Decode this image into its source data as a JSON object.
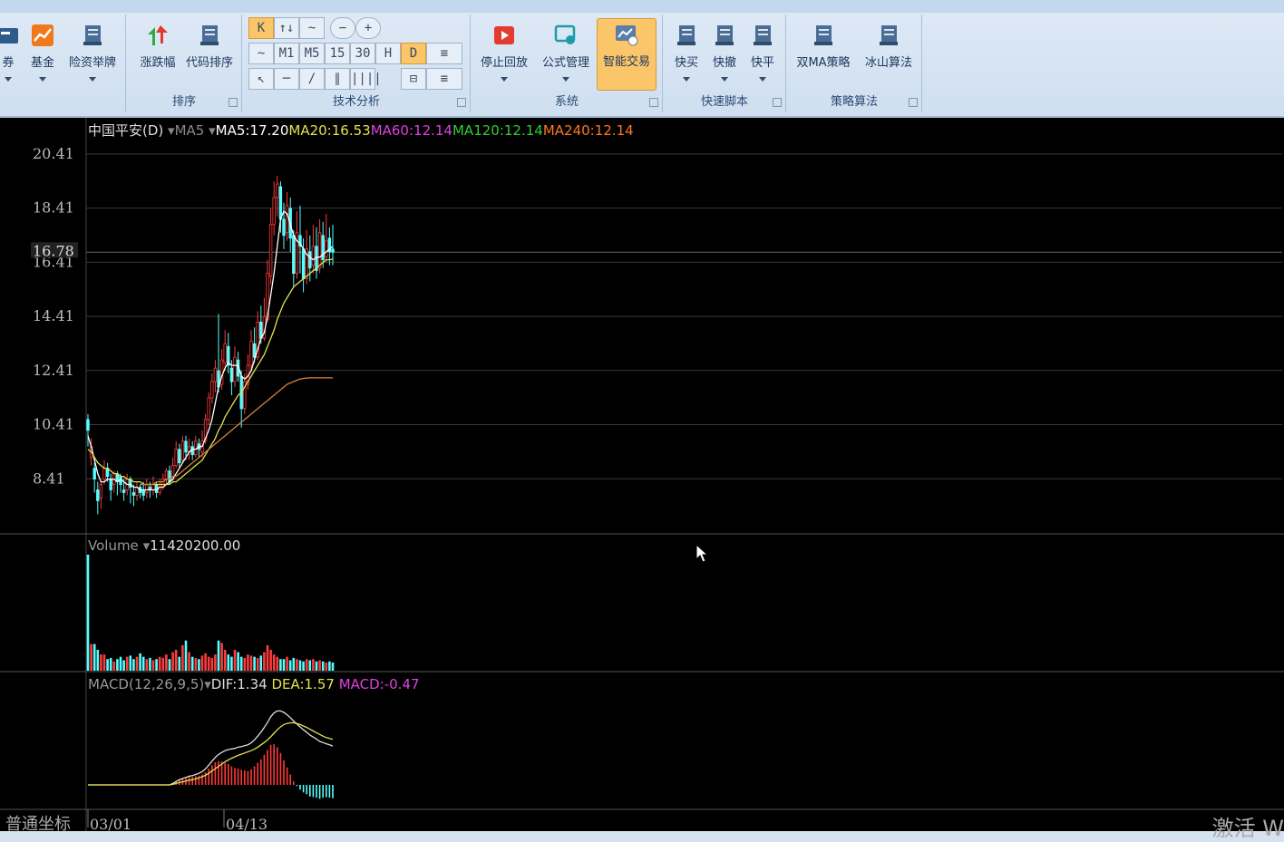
{
  "ribbon": {
    "buttons_left": [
      {
        "label": "券",
        "icon": "card-icon"
      },
      {
        "label": "基金",
        "icon": "fund-chart-icon"
      },
      {
        "label": "险资举牌",
        "icon": "document-icon"
      }
    ],
    "sort_group": {
      "label": "排序",
      "buttons": [
        {
          "label": "涨跌幅",
          "icon": "up-down-arrows-icon"
        },
        {
          "label": "代码排序",
          "icon": "document-icon"
        }
      ]
    },
    "tech_group": {
      "label": "技术分析",
      "row1": [
        "K",
        "↑↓",
        "~",
        "−",
        "+"
      ],
      "row2": [
        "~",
        "M1",
        "M5",
        "15",
        "30",
        "H",
        "D",
        "≡"
      ],
      "row3": [
        "↖",
        "─",
        "/",
        "∥",
        "||||",
        "⊟",
        "≡"
      ]
    },
    "system_group": {
      "label": "系统",
      "buttons": [
        {
          "label": "停止回放",
          "icon": "stop-play-icon"
        },
        {
          "label": "公式管理",
          "icon": "formula-icon"
        },
        {
          "label": "智能交易",
          "icon": "smart-trade-icon",
          "active": true
        }
      ]
    },
    "script_group": {
      "label": "快速脚本",
      "buttons": [
        {
          "label": "快买",
          "icon": "document-icon"
        },
        {
          "label": "快撤",
          "icon": "document-icon"
        },
        {
          "label": "快平",
          "icon": "document-icon"
        }
      ]
    },
    "strategy_group": {
      "label": "策略算法",
      "buttons": [
        {
          "label": "双MA策略",
          "icon": "document-icon"
        },
        {
          "label": "冰山算法",
          "icon": "document-icon"
        }
      ]
    }
  },
  "price_panel": {
    "symbol": "中国平安(D)",
    "indicator": "MA5",
    "ma": [
      {
        "label": "MA5:17.20",
        "color": "#ffffff"
      },
      {
        "label": "MA20:16.53",
        "color": "#e3e34a"
      },
      {
        "label": "MA60:12.14",
        "color": "#e040e0"
      },
      {
        "label": "MA120:12.14",
        "color": "#33cc33"
      },
      {
        "label": "MA240:12.14",
        "color": "#ff7722"
      }
    ],
    "y_ticks": [
      "20.41",
      "18.41",
      "16.41",
      "14.41",
      "12.41",
      "10.41",
      "8.41"
    ],
    "current_price": "16.78"
  },
  "volume_panel": {
    "label": "Volume",
    "value": "11420200.00"
  },
  "macd_panel": {
    "label": "MACD(12,26,9,5)",
    "dif": "DIF:1.34",
    "dea": "DEA:1.57",
    "macd": "MACD:-0.47"
  },
  "x_axis": {
    "coord_mode": "普通坐标",
    "ticks": [
      "03/01",
      "04/13"
    ]
  },
  "chart_data": [
    {
      "type": "candlestick",
      "ylim": [
        6.41,
        21.41
      ],
      "candles": [
        [
          10.6,
          10.2,
          10.8,
          9.6
        ],
        [
          9.2,
          9.6,
          9.9,
          8.9
        ],
        [
          8.8,
          8.4,
          9.0,
          7.9
        ],
        [
          8.0,
          7.6,
          8.3,
          7.1
        ],
        [
          7.7,
          8.2,
          8.3,
          7.3
        ],
        [
          8.4,
          8.8,
          9.1,
          8.2
        ],
        [
          8.8,
          8.5,
          9.0,
          8.3
        ],
        [
          8.4,
          8.0,
          8.6,
          7.6
        ],
        [
          8.2,
          8.6,
          8.7,
          7.9
        ],
        [
          8.6,
          8.3,
          8.7,
          7.8
        ],
        [
          8.5,
          8.2,
          8.6,
          7.9
        ],
        [
          8.0,
          7.9,
          8.4,
          7.6
        ],
        [
          8.0,
          8.4,
          8.6,
          7.8
        ],
        [
          8.4,
          8.1,
          8.5,
          7.5
        ],
        [
          7.9,
          7.8,
          8.2,
          7.4
        ],
        [
          7.8,
          8.1,
          8.3,
          7.6
        ],
        [
          8.1,
          7.9,
          8.2,
          7.7
        ],
        [
          8.0,
          7.8,
          8.3,
          7.6
        ],
        [
          7.9,
          8.2,
          8.4,
          7.7
        ],
        [
          8.1,
          8.0,
          8.3,
          7.7
        ],
        [
          8.0,
          8.2,
          8.5,
          7.8
        ],
        [
          8.2,
          7.9,
          8.3,
          7.7
        ],
        [
          7.9,
          8.1,
          8.4,
          7.8
        ],
        [
          8.1,
          8.4,
          8.6,
          8.0
        ],
        [
          8.4,
          8.7,
          8.8,
          8.2
        ],
        [
          8.7,
          8.3,
          8.9,
          8.2
        ],
        [
          8.4,
          8.9,
          9.2,
          8.3
        ],
        [
          8.9,
          9.5,
          9.8,
          8.8
        ],
        [
          9.5,
          9.0,
          9.7,
          8.8
        ],
        [
          9.1,
          9.8,
          10.0,
          9.0
        ],
        [
          9.8,
          9.4,
          10.0,
          9.1
        ],
        [
          9.4,
          9.6,
          9.9,
          9.1
        ],
        [
          9.6,
          9.3,
          9.8,
          9.1
        ],
        [
          9.3,
          9.8,
          10.0,
          9.2
        ],
        [
          9.7,
          9.5,
          9.9,
          9.2
        ],
        [
          9.4,
          9.8,
          10.2,
          9.2
        ],
        [
          9.8,
          10.6,
          10.8,
          9.7
        ],
        [
          10.6,
          11.4,
          11.6,
          10.4
        ],
        [
          11.4,
          12.0,
          12.3,
          11.2
        ],
        [
          12.0,
          12.5,
          12.8,
          11.6
        ],
        [
          12.4,
          11.8,
          14.5,
          11.6
        ],
        [
          11.9,
          12.8,
          13.2,
          11.7
        ],
        [
          12.7,
          13.4,
          13.9,
          12.4
        ],
        [
          13.3,
          12.6,
          13.8,
          12.3
        ],
        [
          12.5,
          12.0,
          12.8,
          11.5
        ],
        [
          12.0,
          12.9,
          13.3,
          11.8
        ],
        [
          12.8,
          12.2,
          13.1,
          12.0
        ],
        [
          12.2,
          11.0,
          12.4,
          10.3
        ],
        [
          11.0,
          12.0,
          12.3,
          10.8
        ],
        [
          11.9,
          12.6,
          13.0,
          11.7
        ],
        [
          12.6,
          13.5,
          13.9,
          12.4
        ],
        [
          13.4,
          12.9,
          14.0,
          12.7
        ],
        [
          12.9,
          14.2,
          14.6,
          12.8
        ],
        [
          14.2,
          13.6,
          14.8,
          13.4
        ],
        [
          13.6,
          14.4,
          15.1,
          13.5
        ],
        [
          14.3,
          16.0,
          16.5,
          14.2
        ],
        [
          15.9,
          17.8,
          18.4,
          15.6
        ],
        [
          17.8,
          18.8,
          19.4,
          17.4
        ],
        [
          18.8,
          19.3,
          19.6,
          18.1
        ],
        [
          19.2,
          18.0,
          19.4,
          17.5
        ],
        [
          18.0,
          17.4,
          18.6,
          16.9
        ],
        [
          17.5,
          18.5,
          19.0,
          17.2
        ],
        [
          18.4,
          17.3,
          18.8,
          16.8
        ],
        [
          17.4,
          16.0,
          17.6,
          15.5
        ],
        [
          16.0,
          17.5,
          18.3,
          15.8
        ],
        [
          17.4,
          17.0,
          18.5,
          16.0
        ],
        [
          16.9,
          15.8,
          17.3,
          15.3
        ],
        [
          15.8,
          16.9,
          17.6,
          15.6
        ],
        [
          16.8,
          16.2,
          17.4,
          15.7
        ],
        [
          16.3,
          17.0,
          17.8,
          16.0
        ],
        [
          17.0,
          16.1,
          17.7,
          15.8
        ],
        [
          16.2,
          17.5,
          18.0,
          16.0
        ],
        [
          17.4,
          16.5,
          17.9,
          16.2
        ],
        [
          16.6,
          17.2,
          18.2,
          16.4
        ],
        [
          17.3,
          16.8,
          17.7,
          16.3
        ],
        [
          16.9,
          16.78,
          17.8,
          16.3
        ]
      ],
      "ma5": [
        10.0,
        9.6,
        9.1,
        8.6,
        8.3,
        8.3,
        8.4,
        8.4,
        8.4,
        8.3,
        8.4,
        8.3,
        8.2,
        8.2,
        8.1,
        8.1,
        8.0,
        8.0,
        8.0,
        8.0,
        8.0,
        8.0,
        8.1,
        8.1,
        8.2,
        8.3,
        8.4,
        8.6,
        8.8,
        9.0,
        9.2,
        9.4,
        9.5,
        9.5,
        9.6,
        9.6,
        9.9,
        10.2,
        10.6,
        11.2,
        11.8,
        12.2,
        12.5,
        12.7,
        12.6,
        12.6,
        12.6,
        12.2,
        12.1,
        12.2,
        12.4,
        12.8,
        13.2,
        13.6,
        13.8,
        14.4,
        15.2,
        16.0,
        17.0,
        18.0,
        18.3,
        18.2,
        17.8,
        17.4,
        17.2,
        17.1,
        16.9,
        16.7,
        16.6,
        16.5,
        16.6,
        16.6,
        16.7,
        16.8,
        16.9,
        17.0
      ],
      "ma20": [
        9.5,
        9.4,
        9.2,
        9.0,
        8.9,
        8.8,
        8.8,
        8.7,
        8.6,
        8.6,
        8.5,
        8.5,
        8.4,
        8.4,
        8.3,
        8.3,
        8.3,
        8.2,
        8.2,
        8.2,
        8.2,
        8.2,
        8.2,
        8.2,
        8.2,
        8.2,
        8.3,
        8.3,
        8.4,
        8.5,
        8.6,
        8.7,
        8.8,
        8.9,
        9.0,
        9.1,
        9.3,
        9.5,
        9.7,
        9.9,
        10.2,
        10.4,
        10.7,
        10.9,
        11.1,
        11.3,
        11.5,
        11.6,
        11.8,
        12.0,
        12.2,
        12.4,
        12.6,
        12.8,
        13.0,
        13.3,
        13.6,
        13.9,
        14.3,
        14.6,
        14.9,
        15.1,
        15.3,
        15.5,
        15.6,
        15.7,
        15.8,
        15.9,
        16.0,
        16.1,
        16.2,
        16.3,
        16.4,
        16.5,
        16.5,
        16.53
      ],
      "ma60_start": 16,
      "ma60": [
        8.2,
        8.2,
        8.2,
        8.2,
        8.2,
        8.3,
        8.3,
        8.3,
        8.4,
        8.4,
        8.5,
        8.5,
        8.6,
        8.7,
        8.8,
        8.9,
        9.0,
        9.1,
        9.2,
        9.3,
        9.4,
        9.5,
        9.6,
        9.7,
        9.8,
        9.9,
        10.0,
        10.1,
        10.2,
        10.3,
        10.4,
        10.5,
        10.6,
        10.7,
        10.8,
        10.9,
        11.0,
        11.1,
        11.2,
        11.3,
        11.4,
        11.5,
        11.6,
        11.7,
        11.8,
        11.9,
        11.95,
        12.0,
        12.05,
        12.1,
        12.12,
        12.13,
        12.14,
        12.14,
        12.14,
        12.14,
        12.14,
        12.14,
        12.14,
        12.14
      ],
      "volume": [
        1.0,
        0.23,
        0.23,
        0.18,
        0.14,
        0.14,
        0.1,
        0.11,
        0.08,
        0.1,
        0.12,
        0.09,
        0.12,
        0.13,
        0.1,
        0.12,
        0.15,
        0.12,
        0.1,
        0.11,
        0.09,
        0.1,
        0.12,
        0.11,
        0.14,
        0.1,
        0.16,
        0.18,
        0.12,
        0.22,
        0.26,
        0.16,
        0.12,
        0.11,
        0.1,
        0.13,
        0.15,
        0.12,
        0.11,
        0.14,
        0.26,
        0.24,
        0.18,
        0.14,
        0.12,
        0.18,
        0.16,
        0.12,
        0.11,
        0.14,
        0.13,
        0.12,
        0.11,
        0.13,
        0.16,
        0.22,
        0.18,
        0.14,
        0.12,
        0.1,
        0.1,
        0.12,
        0.09,
        0.11,
        0.1,
        0.09,
        0.08,
        0.1,
        0.09,
        0.1,
        0.08,
        0.09,
        0.08,
        0.07,
        0.08,
        0.07
      ],
      "macd_dif": [
        0,
        0,
        0,
        0,
        0,
        0,
        0,
        0,
        0,
        0,
        0,
        0,
        0,
        0,
        0,
        0,
        0,
        0,
        0,
        0,
        0,
        0,
        0,
        0,
        0,
        0,
        0.05,
        0.12,
        0.18,
        0.22,
        0.26,
        0.3,
        0.32,
        0.36,
        0.4,
        0.46,
        0.55,
        0.68,
        0.82,
        0.95,
        1.05,
        1.12,
        1.18,
        1.22,
        1.24,
        1.26,
        1.3,
        1.32,
        1.35,
        1.38,
        1.45,
        1.55,
        1.68,
        1.82,
        1.98,
        2.15,
        2.35,
        2.48,
        2.55,
        2.55,
        2.5,
        2.42,
        2.32,
        2.2,
        2.1,
        2.0,
        1.9,
        1.82,
        1.72,
        1.65,
        1.58,
        1.5,
        1.46,
        1.42,
        1.38,
        1.34
      ],
      "macd_dea": [
        0,
        0,
        0,
        0,
        0,
        0,
        0,
        0,
        0,
        0,
        0,
        0,
        0,
        0,
        0,
        0,
        0,
        0,
        0,
        0,
        0,
        0,
        0,
        0,
        0,
        0,
        0.02,
        0.05,
        0.08,
        0.1,
        0.13,
        0.16,
        0.18,
        0.21,
        0.24,
        0.28,
        0.33,
        0.4,
        0.48,
        0.56,
        0.64,
        0.72,
        0.8,
        0.86,
        0.92,
        0.97,
        1.02,
        1.06,
        1.1,
        1.14,
        1.18,
        1.23,
        1.3,
        1.38,
        1.46,
        1.55,
        1.66,
        1.78,
        1.9,
        2.0,
        2.08,
        2.12,
        2.14,
        2.14,
        2.12,
        2.08,
        2.03,
        1.98,
        1.92,
        1.86,
        1.8,
        1.74,
        1.68,
        1.63,
        1.6,
        1.57
      ]
    }
  ],
  "colors": {
    "up": "#ff3a3a",
    "down": "#54ffff",
    "grid": "#3a3a3a",
    "axis_text": "#bbbbbb"
  },
  "watermark": "激活 W"
}
